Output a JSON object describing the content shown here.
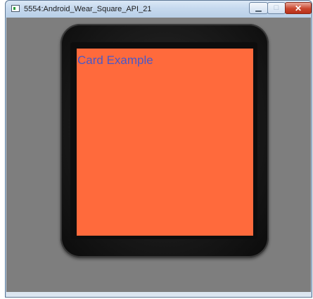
{
  "window": {
    "title": "5554:Android_Wear_Square_API_21",
    "controls": {
      "minimize_icon": "minimize-icon",
      "maximize_icon": "maximize-icon",
      "close_icon": "close-icon",
      "minimize_glyph": "▁",
      "maximize_glyph": "□",
      "close_glyph": "✕"
    }
  },
  "emulator": {
    "screen": {
      "card_title": "Card Example",
      "background_color": "#ff6a3c",
      "text_color": "#4a58c7"
    }
  }
}
